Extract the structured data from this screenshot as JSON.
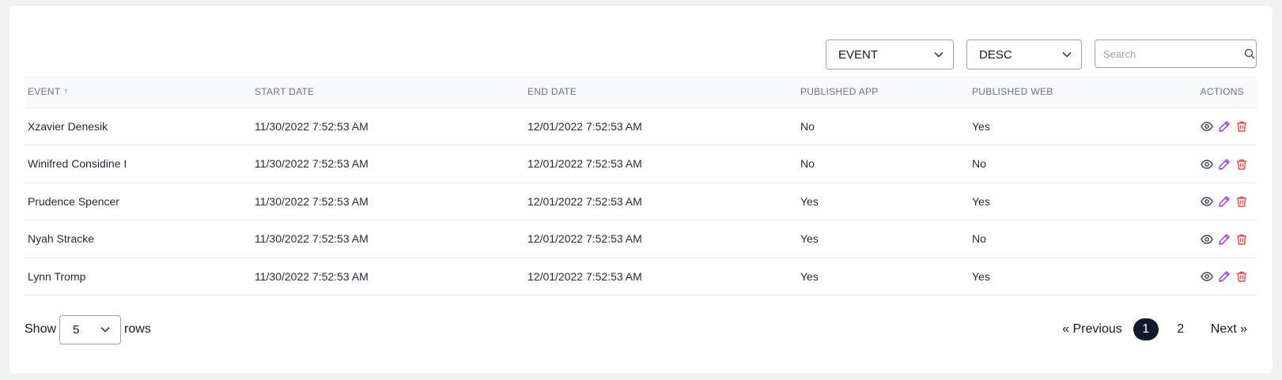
{
  "toolbar": {
    "sort_field": "EVENT",
    "sort_order": "DESC",
    "search_placeholder": "Search"
  },
  "table": {
    "columns": [
      "EVENT",
      "START DATE",
      "END DATE",
      "PUBLISHED APP",
      "PUBLISHED WEB",
      "ACTIONS"
    ],
    "sort_indicator": "↑",
    "rows": [
      {
        "event": "Xzavier Denesik",
        "start": "11/30/2022 7:52:53 AM",
        "end": "12/01/2022 7:52:53 AM",
        "app": "No",
        "web": "Yes"
      },
      {
        "event": "Winifred Considine I",
        "start": "11/30/2022 7:52:53 AM",
        "end": "12/01/2022 7:52:53 AM",
        "app": "No",
        "web": "No"
      },
      {
        "event": "Prudence Spencer",
        "start": "11/30/2022 7:52:53 AM",
        "end": "12/01/2022 7:52:53 AM",
        "app": "Yes",
        "web": "Yes"
      },
      {
        "event": "Nyah Stracke",
        "start": "11/30/2022 7:52:53 AM",
        "end": "12/01/2022 7:52:53 AM",
        "app": "Yes",
        "web": "No"
      },
      {
        "event": "Lynn Tromp",
        "start": "11/30/2022 7:52:53 AM",
        "end": "12/01/2022 7:52:53 AM",
        "app": "Yes",
        "web": "Yes"
      }
    ]
  },
  "footer": {
    "show_label": "Show",
    "rows_value": "5",
    "rows_label": "rows",
    "previous_label": "« Previous",
    "pages": [
      "1",
      "2"
    ],
    "active_page": "1",
    "next_label": "Next »"
  },
  "colors": {
    "view_icon": "#374151",
    "edit_icon": "#9333ea",
    "delete_icon": "#ef4444",
    "active_page_bg": "#0f1b2d"
  },
  "icons": {
    "view": "eye-icon",
    "edit": "pencil-icon",
    "delete": "trash-icon",
    "search": "search-icon",
    "dropdown": "chevron-down-icon"
  }
}
